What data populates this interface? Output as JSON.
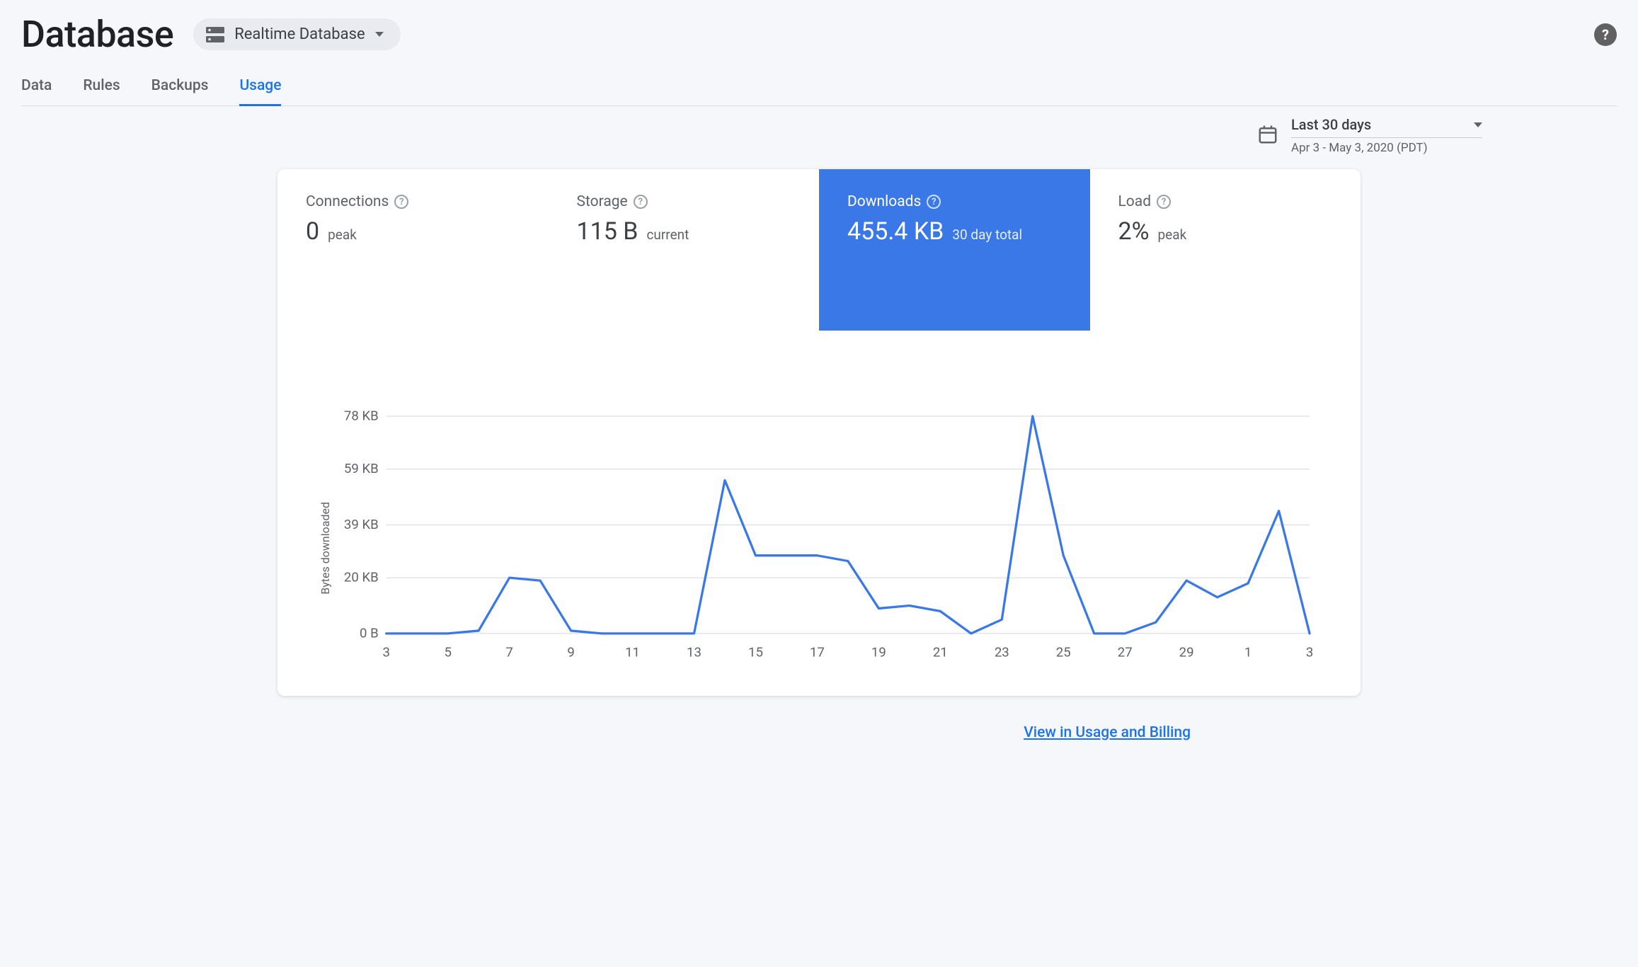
{
  "header": {
    "title": "Database",
    "db_selector_label": "Realtime Database"
  },
  "tabs": [
    {
      "id": "data",
      "label": "Data",
      "active": false
    },
    {
      "id": "rules",
      "label": "Rules",
      "active": false
    },
    {
      "id": "backups",
      "label": "Backups",
      "active": false
    },
    {
      "id": "usage",
      "label": "Usage",
      "active": true
    }
  ],
  "date_picker": {
    "range_label": "Last 30 days",
    "range_detail": "Apr 3 - May 3, 2020 (PDT)"
  },
  "metrics": {
    "connections": {
      "title": "Connections",
      "value": "0",
      "suffix": "peak",
      "active": false
    },
    "storage": {
      "title": "Storage",
      "value": "115 B",
      "suffix": "current",
      "active": false
    },
    "downloads": {
      "title": "Downloads",
      "value": "455.4 KB",
      "suffix": "30 day total",
      "active": true
    },
    "load": {
      "title": "Load",
      "value": "2%",
      "suffix": "peak",
      "active": false
    }
  },
  "chart_data": {
    "type": "line",
    "title": "",
    "xlabel": "",
    "ylabel": "Bytes downloaded",
    "ylim": [
      0,
      78
    ],
    "y_unit": "KB",
    "y_ticks": [
      {
        "v": 0,
        "label": "0 B"
      },
      {
        "v": 20,
        "label": "20 KB"
      },
      {
        "v": 39,
        "label": "39 KB"
      },
      {
        "v": 59,
        "label": "59 KB"
      },
      {
        "v": 78,
        "label": "78 KB"
      }
    ],
    "x_tick_labels": [
      "3",
      "5",
      "7",
      "9",
      "11",
      "13",
      "15",
      "17",
      "19",
      "21",
      "23",
      "25",
      "27",
      "29",
      "1",
      "3"
    ],
    "categories": [
      3,
      4,
      5,
      6,
      7,
      8,
      9,
      10,
      11,
      12,
      13,
      14,
      15,
      16,
      17,
      18,
      19,
      20,
      21,
      22,
      23,
      24,
      25,
      26,
      27,
      28,
      29,
      30,
      1,
      2,
      3
    ],
    "values": [
      0,
      0,
      0,
      1,
      20,
      19,
      1,
      0,
      0,
      0,
      0,
      55,
      28,
      28,
      28,
      26,
      9,
      10,
      8,
      0,
      5,
      80,
      28,
      0,
      0,
      4,
      19,
      13,
      18,
      44,
      0
    ]
  },
  "footer": {
    "view_link": "View in Usage and Billing"
  }
}
